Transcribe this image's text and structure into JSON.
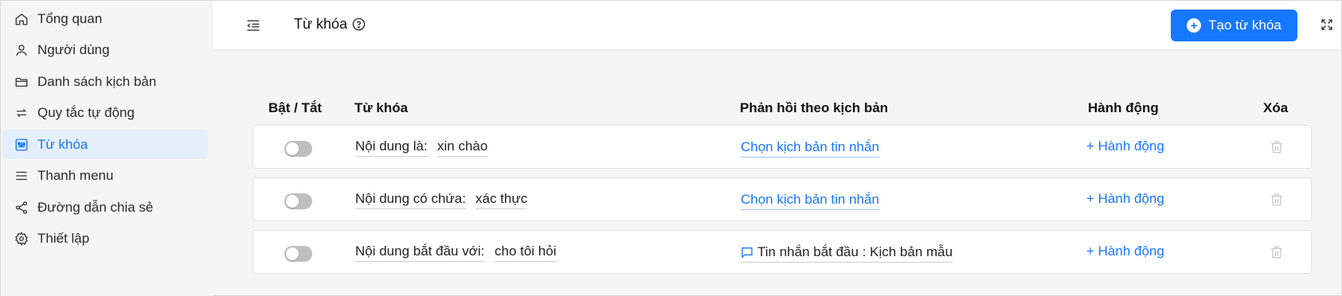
{
  "sidebar": {
    "items": [
      {
        "label": "Tổng quan",
        "icon": "home-icon",
        "active": false
      },
      {
        "label": "Người dùng",
        "icon": "user-icon",
        "active": false
      },
      {
        "label": "Danh sách kịch bản",
        "icon": "folder-icon",
        "active": false
      },
      {
        "label": "Quy tắc tự động",
        "icon": "repeat-icon",
        "active": false
      },
      {
        "label": "Từ khóa",
        "icon": "sliders-icon",
        "active": true
      },
      {
        "label": "Thanh menu",
        "icon": "menu-icon",
        "active": false
      },
      {
        "label": "Đường dẫn chia sẻ",
        "icon": "share-icon",
        "active": false
      },
      {
        "label": "Thiết lập",
        "icon": "gear-icon",
        "active": false
      }
    ]
  },
  "header": {
    "title": "Từ khóa",
    "create_button": "Tạo từ khóa"
  },
  "table": {
    "columns": [
      "Bật / Tắt",
      "Từ khóa",
      "Phản hồi theo kịch bản",
      "Hành động",
      "Xóa"
    ],
    "rows": [
      {
        "enabled": false,
        "condition": "Nội dung là:",
        "keyword": "xin chào",
        "reply": "Chọn kịch bản tin nhắn",
        "reply_is_script": false,
        "action": "+ Hành động"
      },
      {
        "enabled": false,
        "condition": "Nội dung có chứa:",
        "keyword": "xác thực",
        "reply": "Chọn kịch bản tin nhắn",
        "reply_is_script": false,
        "action": "+ Hành động"
      },
      {
        "enabled": false,
        "condition": "Nội dung bắt đầu với:",
        "keyword": "cho tôi hỏi",
        "reply": "Tin nhắn bắt đầu : Kịch bản mẫu",
        "reply_is_script": true,
        "action": "+ Hành động"
      }
    ]
  },
  "colors": {
    "accent": "#1677ff",
    "active_bg": "#e4effc",
    "toggle_off": "#bfbfbf"
  }
}
